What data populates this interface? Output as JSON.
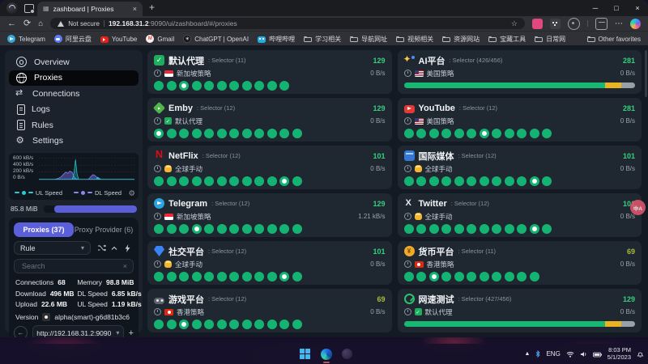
{
  "browser": {
    "tab_title": "zashboard | Proxies",
    "security_label": "Not secure",
    "url_host": "192.168.31.2",
    "url_rest": ":9090/ui/zashboard/#/proxies",
    "other_favorites": "Other favorites",
    "bookmarks": [
      {
        "label": "Telegram",
        "icon": "telegram"
      },
      {
        "label": "阿里云盘",
        "icon": "aliyun"
      },
      {
        "label": "YouTube",
        "icon": "youtube"
      },
      {
        "label": "Gmail",
        "icon": "gmail"
      },
      {
        "label": "ChatGPT | OpenAI",
        "icon": "chatgpt"
      },
      {
        "label": "哔哩哔哩",
        "icon": "bilibili"
      },
      {
        "label": "学习相关",
        "icon": "folder"
      },
      {
        "label": "导航网址",
        "icon": "folder"
      },
      {
        "label": "视频相关",
        "icon": "folder"
      },
      {
        "label": "资源网站",
        "icon": "folder"
      },
      {
        "label": "宝藏工具",
        "icon": "folder"
      },
      {
        "label": "日常网",
        "icon": "folder"
      }
    ]
  },
  "sidebar": {
    "menu": [
      {
        "label": "Overview",
        "icon": "overview",
        "active": false
      },
      {
        "label": "Proxies",
        "icon": "proxies",
        "active": true
      },
      {
        "label": "Connections",
        "icon": "connections",
        "active": false
      },
      {
        "label": "Logs",
        "icon": "logs",
        "active": false
      },
      {
        "label": "Rules",
        "icon": "rules",
        "active": false
      },
      {
        "label": "Settings",
        "icon": "settings",
        "active": false
      }
    ],
    "chart": {
      "y_ticks": [
        "600 kB/s",
        "400 kB/s",
        "200 kB/s",
        "0 B/s"
      ],
      "legend": [
        {
          "label": "UL Speed",
          "color": "#27ccd4"
        },
        {
          "label": "DL Speed",
          "color": "#8d86ef"
        }
      ]
    },
    "memory_bar_label": "85.8 MiB",
    "panel": {
      "tab_proxies": "Proxies (37)",
      "tab_provider": "Proxy Provider (6)",
      "rule_select": "Rule",
      "search_placeholder": "Search",
      "stats": [
        {
          "label": "Connections",
          "value": "68"
        },
        {
          "label": "Memory",
          "value": "98.8 MiB"
        },
        {
          "label": "Download",
          "value": "496 MB"
        },
        {
          "label": "DL Speed",
          "value": "6.85 kB/s"
        },
        {
          "label": "Upload",
          "value": "22.6 MB"
        },
        {
          "label": "UL Speed",
          "value": "1.19 kB/s"
        }
      ],
      "version_label": "Version",
      "version_value": "alpha(smart)-g6d81b3c6",
      "backend_url": "http://192.168.31.2:9090"
    }
  },
  "proxy_groups": [
    {
      "name": "默认代理",
      "icon": "check",
      "type": "Selector (11)",
      "latency": "129",
      "latency_color": "#35d07d",
      "node": "新加坡策略",
      "node_icon": "flag-sg",
      "speed": "0 B/s",
      "display": "dots",
      "count": 11,
      "active": 3
    },
    {
      "name": "AI平台",
      "icon": "ai",
      "type": "Selector (426/456)",
      "latency": "281",
      "latency_color": "#35d07d",
      "node": "美国策略",
      "node_icon": "flag-us",
      "speed": "0 B/s",
      "display": "bar",
      "bar": {
        "green": 87,
        "yellow": 7,
        "gray": 6
      }
    },
    {
      "name": "Emby",
      "icon": "emby",
      "type": "Selector (12)",
      "latency": "129",
      "latency_color": "#35d07d",
      "node": "默认代理",
      "node_icon": "check",
      "speed": "0 B/s",
      "display": "dots",
      "count": 12,
      "active": 1
    },
    {
      "name": "YouTube",
      "icon": "youtube",
      "type": "Selector (12)",
      "latency": "281",
      "latency_color": "#35d07d",
      "node": "美国策略",
      "node_icon": "flag-us",
      "speed": "0 B/s",
      "display": "dots",
      "count": 12,
      "active": 7
    },
    {
      "name": "NetFlix",
      "icon": "netflix",
      "type": "Selector (12)",
      "latency": "101",
      "latency_color": "#35d07d",
      "node": "全球手动",
      "node_icon": "hand",
      "speed": "0 B/s",
      "display": "dots",
      "count": 12,
      "active": 11
    },
    {
      "name": "国际媒体",
      "icon": "media",
      "type": "Selector (12)",
      "latency": "101",
      "latency_color": "#35d07d",
      "node": "全球手动",
      "node_icon": "hand",
      "speed": "0 B/s",
      "display": "dots",
      "count": 12,
      "active": 11
    },
    {
      "name": "Telegram",
      "icon": "telegram",
      "type": "Selector (12)",
      "latency": "129",
      "latency_color": "#35d07d",
      "node": "新加坡策略",
      "node_icon": "flag-sg",
      "speed": "1.21 kB/s",
      "display": "dots",
      "count": 12,
      "active": 4
    },
    {
      "name": "Twitter",
      "icon": "twitter",
      "type": "Selector (12)",
      "latency": "101",
      "latency_color": "#35d07d",
      "node": "全球手动",
      "node_icon": "hand",
      "speed": "0 B/s",
      "display": "dots",
      "count": 12,
      "active": 11
    },
    {
      "name": "社交平台",
      "icon": "social",
      "type": "Selector (12)",
      "latency": "101",
      "latency_color": "#35d07d",
      "node": "全球手动",
      "node_icon": "hand",
      "speed": "0 B/s",
      "display": "dots",
      "count": 12,
      "active": 11
    },
    {
      "name": "货币平台",
      "icon": "currency",
      "type": "Selector (11)",
      "latency": "69",
      "latency_color": "#a9bd3a",
      "node": "香港策略",
      "node_icon": "flag-hk",
      "speed": "0 B/s",
      "display": "dots",
      "count": 11,
      "active": 3
    },
    {
      "name": "游戏平台",
      "icon": "game",
      "type": "Selector (12)",
      "latency": "69",
      "latency_color": "#a9bd3a",
      "node": "香港策略",
      "node_icon": "flag-hk",
      "speed": "0 B/s",
      "display": "dots",
      "count": 12,
      "active": 3
    },
    {
      "name": "网速测试",
      "icon": "speedtest",
      "type": "Selector (427/456)",
      "latency": "129",
      "latency_color": "#35d07d",
      "node": "默认代理",
      "node_icon": "check",
      "speed": "0 B/s",
      "display": "bar",
      "bar": {
        "green": 87,
        "yellow": 7,
        "gray": 6
      }
    }
  ],
  "translate_button": {
    "text": "中A"
  },
  "taskbar": {
    "lang": "ENG",
    "time": "8:03 PM",
    "date": "5/1/2023"
  }
}
